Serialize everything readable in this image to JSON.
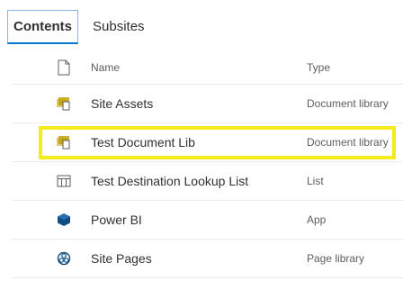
{
  "tabs": [
    {
      "label": "Contents",
      "active": true
    },
    {
      "label": "Subsites",
      "active": false
    }
  ],
  "columns": {
    "name": "Name",
    "type": "Type",
    "file_icon": "file-icon"
  },
  "rows": [
    {
      "name": "Site Assets",
      "type": "Document library",
      "icon": "document-library-icon"
    },
    {
      "name": "Test Document Lib",
      "type": "Document library",
      "icon": "document-library-icon",
      "highlighted": true
    },
    {
      "name": "Test Destination Lookup List",
      "type": "List",
      "icon": "list-icon"
    },
    {
      "name": "Power BI",
      "type": "App",
      "icon": "app-icon"
    },
    {
      "name": "Site Pages",
      "type": "Page library",
      "icon": "page-library-icon"
    }
  ],
  "colors": {
    "highlight": "#f5ea1a",
    "accent": "#0078d4",
    "library_icon": "#c19c00",
    "app_icon": "#0f4c81"
  }
}
